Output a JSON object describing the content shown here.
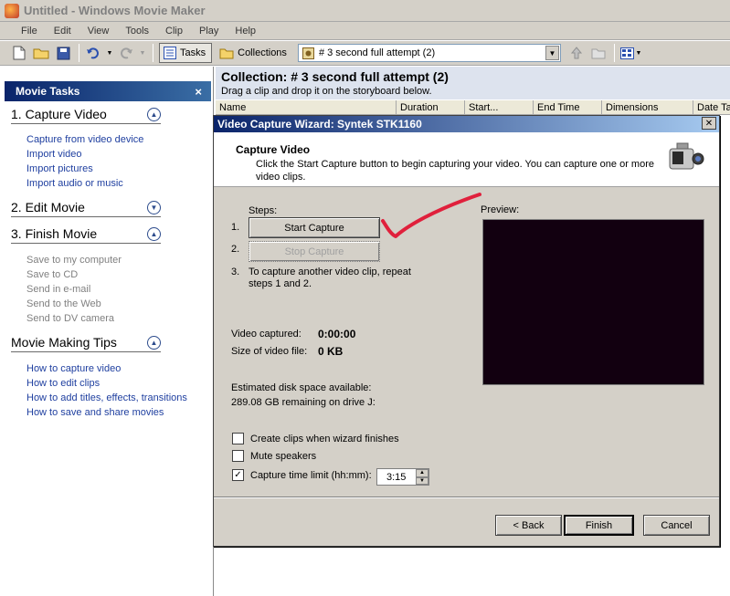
{
  "window": {
    "title": "Untitled - Windows Movie Maker"
  },
  "menu": [
    "File",
    "Edit",
    "View",
    "Tools",
    "Clip",
    "Play",
    "Help"
  ],
  "toolbar": {
    "tasks_label": "Tasks",
    "collections_label": "Collections",
    "collection_select": "# 3 second full attempt (2)"
  },
  "task_pane": {
    "title": "Movie Tasks",
    "sections": [
      {
        "title": "1. Capture Video",
        "expanded": true,
        "items": [
          "Capture from video device",
          "Import video",
          "Import pictures",
          "Import audio or music"
        ]
      },
      {
        "title": "2. Edit Movie",
        "expanded": false,
        "items": []
      },
      {
        "title": "3. Finish Movie",
        "expanded": true,
        "items": [
          "Save to my computer",
          "Save to CD",
          "Send in e-mail",
          "Send to the Web",
          "Send to DV camera"
        ]
      },
      {
        "title": "Movie Making Tips",
        "expanded": true,
        "items": [
          "How to capture video",
          "How to edit clips",
          "How to add titles, effects, transitions",
          "How to save and share movies"
        ]
      }
    ]
  },
  "collection": {
    "title": "Collection: # 3 second full attempt (2)",
    "subtitle": "Drag a clip and drop it on the storyboard below.",
    "columns": [
      "Name",
      "Duration",
      "Start...",
      "End Time",
      "Dimensions",
      "Date Ta"
    ]
  },
  "wizard": {
    "title": "Video Capture Wizard: Syntek STK1160",
    "header_title": "Capture Video",
    "header_desc": "Click the Start Capture button to begin capturing your video. You can capture one or more video clips.",
    "steps_label": "Steps:",
    "step1_num": "1.",
    "step2_num": "2.",
    "step3_num": "3.",
    "start_capture": "Start Capture",
    "stop_capture": "Stop Capture",
    "step3_text": "To capture another video clip, repeat steps 1 and 2.",
    "video_captured_label": "Video captured:",
    "video_captured_value": "0:00:00",
    "file_size_label": "Size of video file:",
    "file_size_value": "0 KB",
    "disk_space_label": "Estimated disk space available:",
    "disk_space_value": "289.08 GB remaining on drive J:",
    "preview_label": "Preview:",
    "create_clips_label": "Create clips when wizard finishes",
    "create_clips_checked": false,
    "mute_label": "Mute speakers",
    "mute_checked": false,
    "time_limit_label": "Capture time limit (hh:mm):",
    "time_limit_checked": true,
    "time_limit_value": "3:15",
    "back_label": "< Back",
    "finish_label": "Finish",
    "cancel_label": "Cancel"
  },
  "colors": {
    "title_gradient_start": "#0a246a",
    "link": "#2040a0",
    "annotation_stroke": "#e0203c"
  }
}
